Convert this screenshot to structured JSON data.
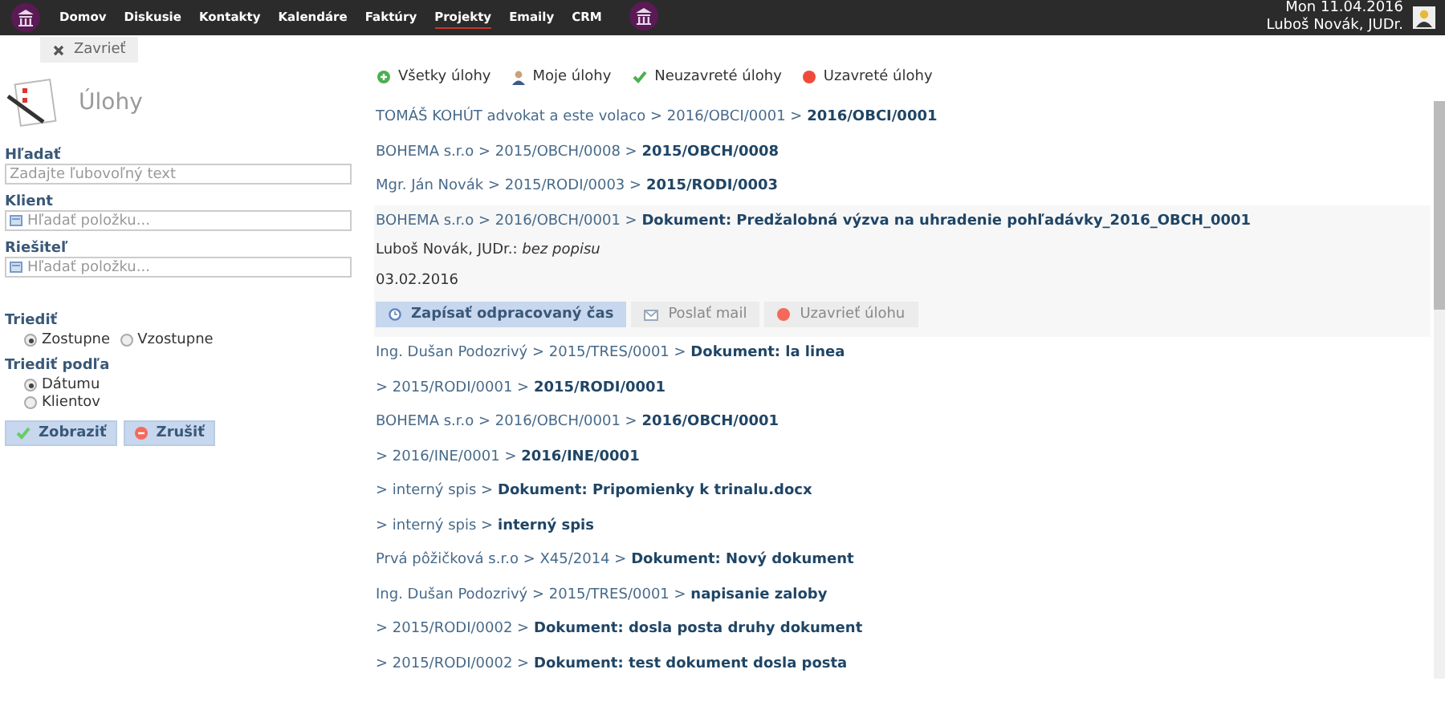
{
  "nav": [
    {
      "label": "Domov",
      "selected": false
    },
    {
      "label": "Diskusie",
      "selected": false
    },
    {
      "label": "Kontakty",
      "selected": false
    },
    {
      "label": "Kalendáre",
      "selected": false
    },
    {
      "label": "Faktúry",
      "selected": false
    },
    {
      "label": "Projekty",
      "selected": true
    },
    {
      "label": "Emaily",
      "selected": false
    },
    {
      "label": "CRM",
      "selected": false
    }
  ],
  "user": {
    "date": "Mon 11.04.2016",
    "name": "Luboš Novák, JUDr."
  },
  "close_button": "Zavrieť",
  "sidebar": {
    "title": "Úlohy",
    "fields": [
      {
        "label": "Hľadať",
        "placeholder": "Zadajte ľubovoľný text",
        "kind": "text"
      },
      {
        "label": "Klient",
        "placeholder": "Hľadať položku...",
        "kind": "lookup"
      },
      {
        "label": "Riešiteľ",
        "placeholder": "Hľadať položku...",
        "kind": "lookup"
      }
    ],
    "sort_label": "Triediť",
    "sort_options": [
      {
        "label": "Zostupne",
        "selected": true
      },
      {
        "label": "Vzostupne",
        "selected": false
      }
    ],
    "sort_by_label": "Triediť podľa",
    "sort_by_options": [
      {
        "label": "Dátumu",
        "selected": true
      },
      {
        "label": "Klientov",
        "selected": false
      }
    ],
    "buttons": [
      {
        "label": "Zobraziť",
        "kind": "ok"
      },
      {
        "label": "Zrušiť",
        "kind": "cancel"
      }
    ]
  },
  "filters": [
    {
      "label": "Všetky úlohy",
      "kind": "all"
    },
    {
      "label": "Moje úlohy",
      "kind": "mine"
    },
    {
      "label": "Neuzavreté úlohy",
      "kind": "open"
    },
    {
      "label": "Uzavreté úlohy",
      "kind": "closed"
    }
  ],
  "tasks": [
    {
      "path": "TOMÁŠ KOHÚT advokat a este volaco > 2016/OBCI/0001 >",
      "title": "2016/OBCI/0001",
      "expanded": false
    },
    {
      "path": "BOHEMA s.r.o > 2015/OBCH/0008 >",
      "title": "2015/OBCH/0008",
      "expanded": false
    },
    {
      "path": "Mgr. Ján Novák > 2015/RODI/0003 >",
      "title": "2015/RODI/0003",
      "expanded": false
    },
    {
      "path": "BOHEMA s.r.o > 2016/OBCH/0001 >",
      "title": "Dokument: Predžalobná výzva na uhradenie pohľadávky_2016_OBCH_0001",
      "expanded": true,
      "author": "Luboš Novák, JUDr.:",
      "description": "bez popisu",
      "date": "03.02.2016",
      "actions": [
        {
          "label": "Zapísať odpracovaný čas",
          "kind": "time"
        },
        {
          "label": "Poslať mail",
          "kind": "mail"
        },
        {
          "label": "Uzavrieť úlohu",
          "kind": "close"
        }
      ]
    },
    {
      "path": "Ing. Dušan Podozrivý > 2015/TRES/0001 >",
      "title": "Dokument: la linea",
      "expanded": false
    },
    {
      "path": "> 2015/RODI/0001 >",
      "title": "2015/RODI/0001",
      "expanded": false
    },
    {
      "path": "BOHEMA s.r.o > 2016/OBCH/0001 >",
      "title": "2016/OBCH/0001",
      "expanded": false
    },
    {
      "path": "> 2016/INE/0001 >",
      "title": "2016/INE/0001",
      "expanded": false
    },
    {
      "path": "> interný spis >",
      "title": "Dokument: Pripomienky k trinalu.docx",
      "expanded": false
    },
    {
      "path": "> interný spis >",
      "title": "interný spis",
      "expanded": false
    },
    {
      "path": "Prvá pôžičková s.r.o > X45/2014 >",
      "title": "Dokument: Nový dokument",
      "expanded": false
    },
    {
      "path": "Ing. Dušan Podozrivý > 2015/TRES/0001 >",
      "title": "napisanie zaloby",
      "expanded": false
    },
    {
      "path": "> 2015/RODI/0002 >",
      "title": "Dokument: dosla posta druhy dokument",
      "expanded": false
    },
    {
      "path": "> 2015/RODI/0002 >",
      "title": "Dokument: test dokument dosla posta",
      "expanded": false
    }
  ]
}
